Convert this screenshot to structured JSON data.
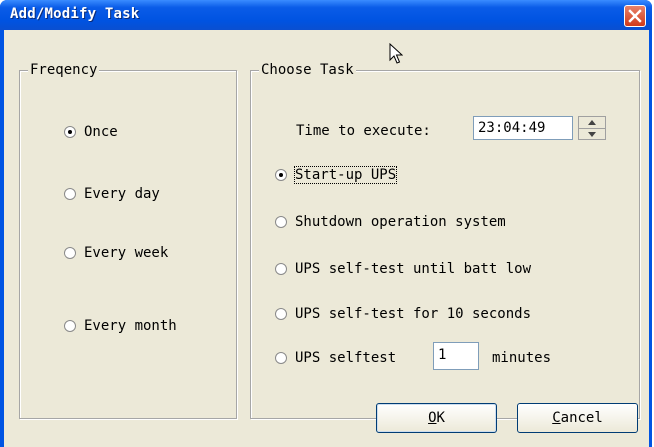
{
  "window": {
    "title": "Add/Modify Task",
    "close_icon": "close-icon"
  },
  "frequency": {
    "legend": "Freqency",
    "options": [
      {
        "label": "Once",
        "checked": true
      },
      {
        "label": "Every day",
        "checked": false
      },
      {
        "label": "Every week",
        "checked": false
      },
      {
        "label": "Every month",
        "checked": false
      }
    ]
  },
  "task": {
    "legend": "Choose Task",
    "time_label": "Time to execute:",
    "time_value": "23:04:49",
    "options": [
      {
        "label": "Start-up UPS",
        "checked": true
      },
      {
        "label": "Shutdown operation system",
        "checked": false
      },
      {
        "label": "UPS self-test until batt low",
        "checked": false
      },
      {
        "label": "UPS self-test for 10 seconds",
        "checked": false
      }
    ],
    "selftest_prefix": "UPS selftest",
    "selftest_minutes": "1",
    "selftest_suffix": "minutes"
  },
  "buttons": {
    "ok_mnemonic": "O",
    "ok_rest": "K",
    "cancel_mnemonic": "C",
    "cancel_rest": "ancel"
  },
  "colors": {
    "titlebar": "#0a5ce8",
    "client": "#ece9d8",
    "close": "#d13a1a"
  }
}
